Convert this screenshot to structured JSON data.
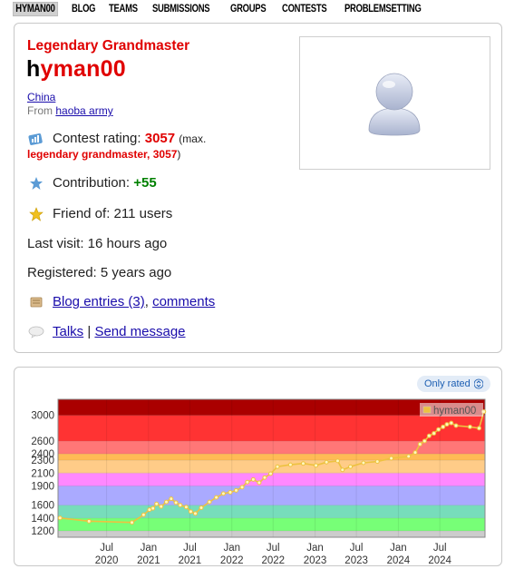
{
  "nav": {
    "items": [
      "HYMAN00",
      "BLOG",
      "TEAMS",
      "SUBMISSIONS",
      "GROUPS",
      "CONTESTS",
      "PROBLEMSETTING"
    ],
    "active_index": 0
  },
  "profile": {
    "rank": "Legendary Grandmaster",
    "handle_first": "h",
    "handle_rest": "yman00",
    "country": "China",
    "from_label": "From",
    "org": "haoba army",
    "rating_label": "Contest rating:",
    "rating_value": "3057",
    "max_prefix": "(max.",
    "max_detail": "legendary grandmaster, 3057",
    "max_suffix": ")",
    "contribution_label": "Contribution:",
    "contribution_value": "+55",
    "friend_text": "Friend of: 211 users",
    "last_visit": "Last visit: 16 hours ago",
    "registered": "Registered: 5 years ago",
    "blog_link": "Blog entries (3)",
    "blog_sep": ",",
    "comments_link": "comments",
    "talks_link": "Talks",
    "talks_sep": "|",
    "send_message_link": "Send message"
  },
  "chart_toggle": {
    "label": "Only rated",
    "icon": "updown-chevron-icon"
  },
  "chart_data": {
    "type": "line",
    "series": [
      {
        "name": "hyman00",
        "color": "#edc240",
        "points": [
          [
            "2019-12-10",
            1400
          ],
          [
            "2020-04-15",
            1350
          ],
          [
            "2020-10-20",
            1330
          ],
          [
            "2020-12-10",
            1450
          ],
          [
            "2021-01-05",
            1530
          ],
          [
            "2021-01-20",
            1550
          ],
          [
            "2021-02-05",
            1620
          ],
          [
            "2021-02-25",
            1580
          ],
          [
            "2021-03-20",
            1650
          ],
          [
            "2021-04-10",
            1700
          ],
          [
            "2021-05-01",
            1640
          ],
          [
            "2021-05-20",
            1600
          ],
          [
            "2021-06-15",
            1570
          ],
          [
            "2021-07-05",
            1500
          ],
          [
            "2021-07-25",
            1470
          ],
          [
            "2021-08-20",
            1560
          ],
          [
            "2021-09-25",
            1650
          ],
          [
            "2021-10-25",
            1720
          ],
          [
            "2021-11-25",
            1780
          ],
          [
            "2021-12-25",
            1800
          ],
          [
            "2022-01-20",
            1830
          ],
          [
            "2022-02-15",
            1880
          ],
          [
            "2022-03-10",
            1960
          ],
          [
            "2022-04-05",
            2000
          ],
          [
            "2022-05-01",
            1950
          ],
          [
            "2022-05-25",
            2030
          ],
          [
            "2022-06-20",
            2090
          ],
          [
            "2022-07-20",
            2200
          ],
          [
            "2022-09-15",
            2230
          ],
          [
            "2022-11-10",
            2250
          ],
          [
            "2023-01-05",
            2220
          ],
          [
            "2023-02-20",
            2270
          ],
          [
            "2023-04-10",
            2290
          ],
          [
            "2023-05-01",
            2150
          ],
          [
            "2023-06-05",
            2200
          ],
          [
            "2023-08-01",
            2260
          ],
          [
            "2023-10-01",
            2280
          ],
          [
            "2023-12-01",
            2330
          ],
          [
            "2024-02-15",
            2360
          ],
          [
            "2024-03-15",
            2420
          ],
          [
            "2024-04-05",
            2550
          ],
          [
            "2024-04-25",
            2600
          ],
          [
            "2024-05-15",
            2680
          ],
          [
            "2024-06-05",
            2720
          ],
          [
            "2024-06-25",
            2780
          ],
          [
            "2024-07-15",
            2820
          ],
          [
            "2024-08-01",
            2860
          ],
          [
            "2024-08-20",
            2880
          ],
          [
            "2024-09-10",
            2840
          ],
          [
            "2024-11-10",
            2820
          ],
          [
            "2024-12-20",
            2800
          ],
          [
            "2025-01-10",
            3057
          ]
        ]
      }
    ],
    "y_ticks": [
      1200,
      1400,
      1600,
      1900,
      2100,
      2300,
      2400,
      2600,
      3000
    ],
    "ylim": [
      1100,
      3250
    ],
    "xlim": [
      "2019-12-01",
      "2025-01-15"
    ],
    "x_ticks": [
      {
        "date": "2020-07-01",
        "l1": "Jul",
        "l2": "2020"
      },
      {
        "date": "2021-01-01",
        "l1": "Jan",
        "l2": "2021"
      },
      {
        "date": "2021-07-01",
        "l1": "Jul",
        "l2": "2021"
      },
      {
        "date": "2022-01-01",
        "l1": "Jan",
        "l2": "2022"
      },
      {
        "date": "2022-07-01",
        "l1": "Jul",
        "l2": "2022"
      },
      {
        "date": "2023-01-01",
        "l1": "Jan",
        "l2": "2023"
      },
      {
        "date": "2023-07-01",
        "l1": "Jul",
        "l2": "2023"
      },
      {
        "date": "2024-01-01",
        "l1": "Jan",
        "l2": "2024"
      },
      {
        "date": "2024-07-01",
        "l1": "Jul",
        "l2": "2024"
      }
    ],
    "bands": [
      {
        "from": 1100,
        "to": 1200,
        "color": "#cccccc"
      },
      {
        "from": 1200,
        "to": 1400,
        "color": "#77ff77"
      },
      {
        "from": 1400,
        "to": 1600,
        "color": "#77ddbb"
      },
      {
        "from": 1600,
        "to": 1900,
        "color": "#aaaaff"
      },
      {
        "from": 1900,
        "to": 2100,
        "color": "#ff88ff"
      },
      {
        "from": 2100,
        "to": 2300,
        "color": "#ffcc88"
      },
      {
        "from": 2300,
        "to": 2400,
        "color": "#ffbb55"
      },
      {
        "from": 2400,
        "to": 2600,
        "color": "#ff7777"
      },
      {
        "from": 2600,
        "to": 3000,
        "color": "#ff3333"
      },
      {
        "from": 3000,
        "to": 3250,
        "color": "#aa0000"
      }
    ],
    "grid": true,
    "legend": "top-right"
  }
}
